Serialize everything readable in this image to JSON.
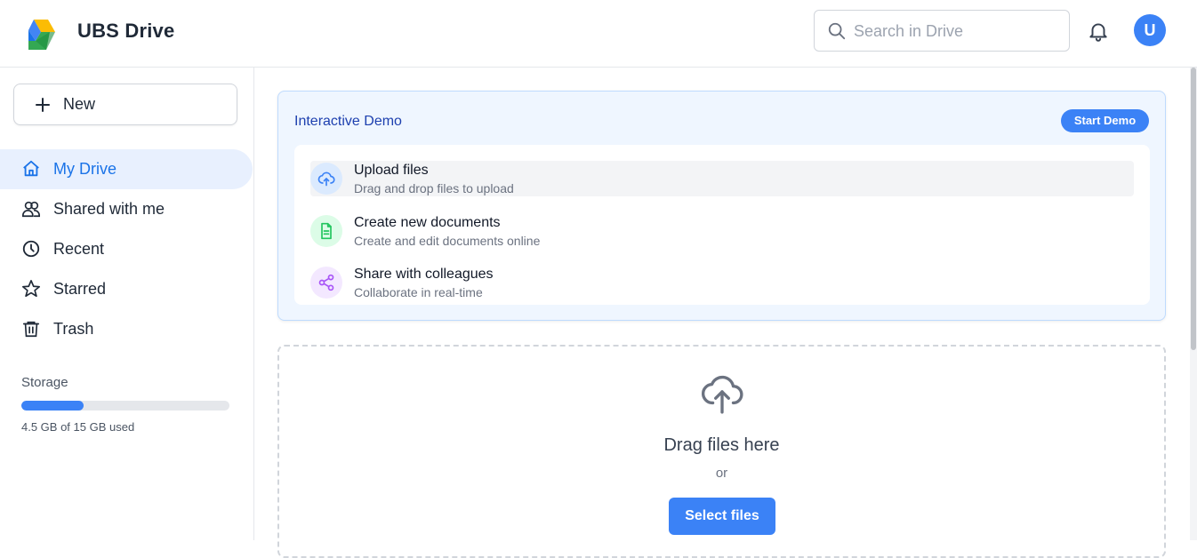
{
  "header": {
    "title": "UBS Drive",
    "search_placeholder": "Search in Drive",
    "avatar_initial": "U"
  },
  "sidebar": {
    "new_label": "New",
    "items": [
      {
        "label": "My Drive",
        "icon": "home-icon",
        "active": true
      },
      {
        "label": "Shared with me",
        "icon": "users-icon",
        "active": false
      },
      {
        "label": "Recent",
        "icon": "clock-icon",
        "active": false
      },
      {
        "label": "Starred",
        "icon": "star-icon",
        "active": false
      },
      {
        "label": "Trash",
        "icon": "trash-icon",
        "active": false
      }
    ],
    "storage": {
      "title": "Storage",
      "used_text": "4.5 GB of 15 GB used",
      "used_fraction": 0.3
    }
  },
  "demo": {
    "title": "Interactive Demo",
    "start_label": "Start Demo",
    "items": [
      {
        "title": "Upload files",
        "desc": "Drag and drop files to upload",
        "icon": "cloud-upload-icon"
      },
      {
        "title": "Create new documents",
        "desc": "Create and edit documents online",
        "icon": "document-icon"
      },
      {
        "title": "Share with colleagues",
        "desc": "Collaborate in real-time",
        "icon": "share-icon"
      }
    ]
  },
  "dropzone": {
    "title": "Drag files here",
    "or_text": "or",
    "select_label": "Select files",
    "icon": "cloud-upload-icon"
  },
  "colors": {
    "accent": "#3b82f6",
    "active_nav_bg": "#e8f0fe",
    "active_nav_text": "#1a73e8",
    "demo_bg": "#eff6ff"
  }
}
